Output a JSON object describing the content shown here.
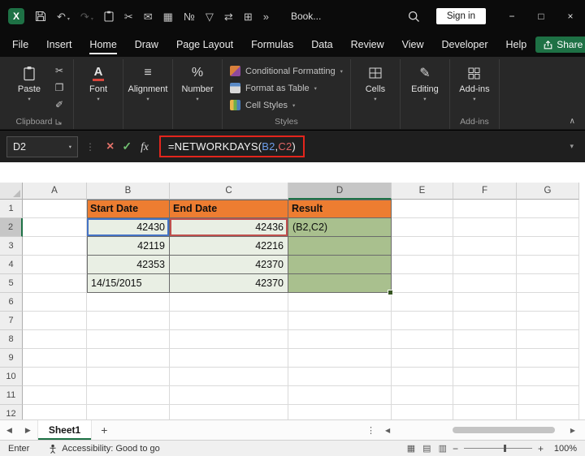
{
  "titlebar": {
    "workbook_name": "Book...",
    "signin": "Sign in"
  },
  "menubar": {
    "tabs": [
      "File",
      "Insert",
      "Home",
      "Draw",
      "Page Layout",
      "Formulas",
      "Data",
      "Review",
      "View",
      "Developer",
      "Help"
    ],
    "active_tab": "Home",
    "share": "Share"
  },
  "ribbon": {
    "paste": "Paste",
    "font": "Font",
    "alignment": "Alignment",
    "number": "Number",
    "styles_items": [
      "Conditional Formatting",
      "Format as Table",
      "Cell Styles"
    ],
    "cells": "Cells",
    "editing": "Editing",
    "addins": "Add-ins",
    "labels": {
      "clipboard": "Clipboard",
      "styles": "Styles",
      "addins": "Add-ins"
    }
  },
  "formula_bar": {
    "name_box": "D2",
    "fx": "fx",
    "formula": {
      "prefix": "=NETWORKDAYS(",
      "ref1": "B2",
      "comma": ",",
      "ref2": "C2",
      "suffix": ")"
    }
  },
  "grid": {
    "columns": [
      "A",
      "B",
      "C",
      "D",
      "E",
      "F",
      "G"
    ],
    "selected_column": "D",
    "rows": [
      "1",
      "2",
      "3",
      "4",
      "5",
      "6",
      "7",
      "8",
      "9",
      "10",
      "11",
      "12"
    ],
    "selected_row": "2",
    "header_row": [
      "Start Date",
      "End Date",
      "Result"
    ],
    "data": [
      [
        "42430",
        "42436",
        "(B2,C2)"
      ],
      [
        "42119",
        "42216",
        ""
      ],
      [
        "42353",
        "42370",
        ""
      ],
      [
        "14/15/2015",
        "42370",
        ""
      ]
    ]
  },
  "sheetbar": {
    "sheet": "Sheet1"
  },
  "statusbar": {
    "mode": "Enter",
    "accessibility": "Accessibility: Good to go",
    "zoom": "100%"
  },
  "icons": {
    "logo_x": "X",
    "undo": "↶",
    "redo": "↷",
    "scissors": "✂",
    "copy": "❐",
    "painter": "✐",
    "mail": "✉",
    "grid_view": "▦",
    "number_format": "№",
    "filter": "▽",
    "swap": "⇄",
    "borders": "⊞",
    "overflow": "»",
    "chevron_down": "▾",
    "dots_vertical": "⋮",
    "cancel": "×",
    "check": "✓",
    "minimize": "−",
    "maximize": "□",
    "close": "×",
    "back": "◀",
    "forward": "▶",
    "collapse": "∧",
    "alignment_glyph": "≡",
    "font_glyph": "A",
    "percent": "%",
    "editing_glyph": "✎",
    "add_sheet": "+",
    "view_normal": "▦",
    "view_page": "▤",
    "view_break": "▥",
    "zoom_out": "−",
    "zoom_in": "+"
  },
  "colors": {
    "accent_green": "#1E7145",
    "header_orange": "#ED7D31",
    "result_green": "#A9C08E",
    "range_green": "#E9EFE4",
    "ref_blue": "#4472C4",
    "ref_red": "#C0504D",
    "annotation_red": "#E3251C"
  }
}
